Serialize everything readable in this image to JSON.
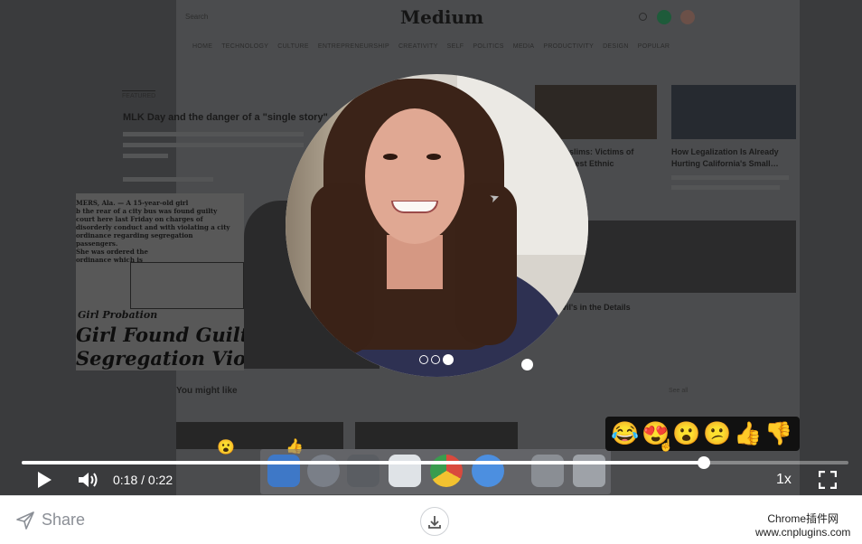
{
  "background_page": {
    "logo": "Medium",
    "search_placeholder": "Search",
    "nav_items": [
      "HOME",
      "TECHNOLOGY",
      "CULTURE",
      "ENTREPRENEURSHIP",
      "CREATIVITY",
      "SELF",
      "POLITICS",
      "MEDIA",
      "PRODUCTIVITY",
      "DESIGN",
      "POPULAR"
    ],
    "featured_label": "FEATURED",
    "featured_headline": "MLK Day and the danger of a \"single story\"",
    "card1_title": "Muslims: Victims of\nLargest Ethnic",
    "card2_title": "How Legalization Is Already\nHurting California's Small…",
    "card3_title": "evil's in the Details",
    "you_might_like": "You might like",
    "see_all": "See all",
    "newspaper": {
      "sub": "Girl Probation",
      "head1": "Girl Found Guilty",
      "head2": "Segregation Violation"
    }
  },
  "webcam": {
    "pages": 3,
    "active_page": 3
  },
  "reactions": {
    "items": [
      {
        "name": "laugh",
        "emoji": "😂"
      },
      {
        "name": "love",
        "emoji": "😍"
      },
      {
        "name": "wow",
        "emoji": "😮"
      },
      {
        "name": "meh",
        "emoji": "😕"
      },
      {
        "name": "thumbs-up",
        "emoji": "👍"
      },
      {
        "name": "thumbs-down",
        "emoji": "👎"
      }
    ],
    "floating": [
      "😮",
      "👍"
    ]
  },
  "player": {
    "current_time": "0:18",
    "separator": "/",
    "duration": "0:22",
    "progress": 0.825,
    "speed": "1x"
  },
  "footer": {
    "share_label": "Share",
    "watermark_line1": "Chrome插件网",
    "watermark_line2": "www.cnplugins.com"
  },
  "colors": {
    "dim_overlay": "#3a3b3d",
    "reaction_bar": "#111111",
    "share_text": "#8b8f96"
  }
}
